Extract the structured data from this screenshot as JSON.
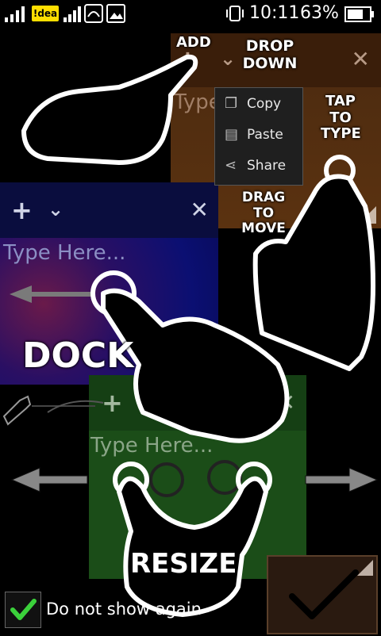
{
  "status_bar": {
    "carrier": "!dea",
    "time": "10:11",
    "battery_percent": "63%"
  },
  "panels": {
    "brown": {
      "placeholder": "Type"
    },
    "blue": {
      "placeholder": "Type Here..."
    },
    "green": {
      "placeholder": "Type Here..."
    }
  },
  "context_menu": {
    "items": [
      {
        "label": "Copy",
        "icon": "copy-icon"
      },
      {
        "label": "Paste",
        "icon": "paste-icon"
      },
      {
        "label": "Share",
        "icon": "share-icon"
      }
    ]
  },
  "hints": {
    "add": "ADD",
    "drop_down": "DROP DOWN",
    "tap_to_type": "TAP TO TYPE",
    "drag_to_move": "DRAG TO MOVE",
    "dock": "DOCK",
    "resize": "RESIZE"
  },
  "footer": {
    "dont_show_label": "Do not show again",
    "checkbox_checked": true
  },
  "colors": {
    "brown_panel": "#5b3210",
    "blue_panel": "#0b0f72",
    "green_panel": "#1b4d18",
    "check_green": "#3bd13b"
  }
}
